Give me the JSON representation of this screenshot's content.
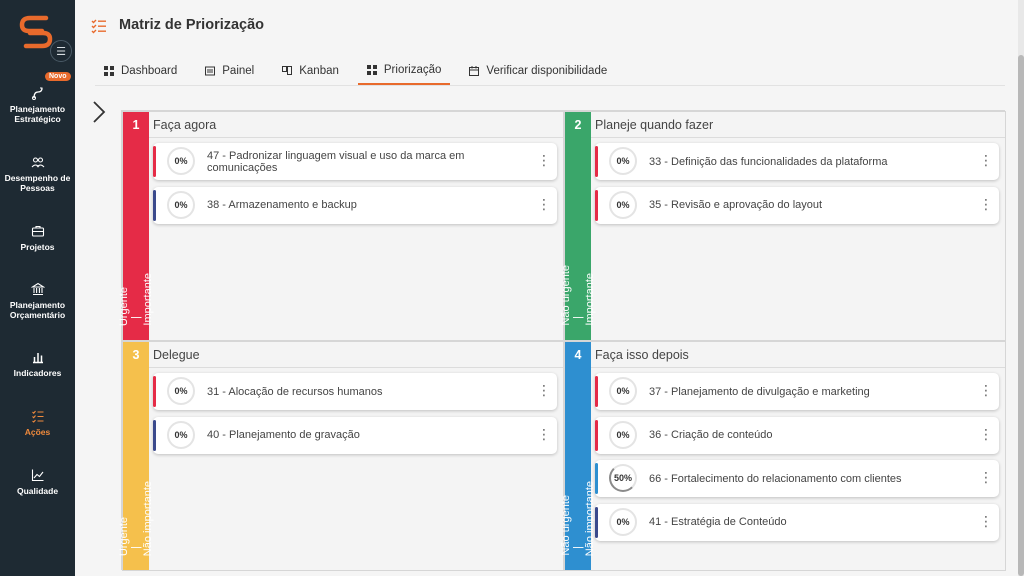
{
  "brand": {
    "accent": "#e86a2c",
    "sidebar_bg": "#1e2a33"
  },
  "sidebar": {
    "new_badge": "Novo",
    "items": [
      {
        "label": "Planejamento Estratégico",
        "icon": "route-icon"
      },
      {
        "label": "Desempenho de Pessoas",
        "icon": "people-icon"
      },
      {
        "label": "Projetos",
        "icon": "briefcase-icon"
      },
      {
        "label": "Planejamento Orçamentário",
        "icon": "bank-icon"
      },
      {
        "label": "Indicadores",
        "icon": "bar-chart-icon"
      },
      {
        "label": "Ações",
        "icon": "checklist-icon",
        "active": true
      },
      {
        "label": "Qualidade",
        "icon": "trend-icon"
      }
    ]
  },
  "header": {
    "title": "Matriz de Priorização",
    "tabs": [
      {
        "label": "Dashboard"
      },
      {
        "label": "Painel"
      },
      {
        "label": "Kanban"
      },
      {
        "label": "Priorização",
        "active": true
      },
      {
        "label": "Verificar disponibilidade"
      }
    ]
  },
  "quadrants": [
    {
      "num": "1",
      "title": "Faça agora",
      "label_a": "Urgente",
      "label_b": "Importante",
      "color": "#e52b47",
      "cards": [
        {
          "pct": "0%",
          "text": "47 - Padronizar linguagem visual e uso da marca em comunicações",
          "bar": "#e52b47"
        },
        {
          "pct": "0%",
          "text": "38 - Armazenamento e backup",
          "bar": "#3b4a8c"
        }
      ]
    },
    {
      "num": "2",
      "title": "Planeje quando fazer",
      "label_a": "Não urgente",
      "label_b": "Importante",
      "color": "#3aa66a",
      "cards": [
        {
          "pct": "0%",
          "text": "33 - Definição das funcionalidades da plataforma",
          "bar": "#e52b47"
        },
        {
          "pct": "0%",
          "text": "35 - Revisão e aprovação do layout",
          "bar": "#e52b47"
        }
      ]
    },
    {
      "num": "3",
      "title": "Delegue",
      "label_a": "Urgente",
      "label_b": "Não importante",
      "color": "#f5c04c",
      "cards": [
        {
          "pct": "0%",
          "text": "31 - Alocação de recursos humanos",
          "bar": "#e52b47"
        },
        {
          "pct": "0%",
          "text": "40 - Planejamento de gravação",
          "bar": "#3b4a8c"
        }
      ]
    },
    {
      "num": "4",
      "title": "Faça isso depois",
      "label_a": "Não urgente",
      "label_b": "Não importante",
      "color": "#2e8fd0",
      "cards": [
        {
          "pct": "0%",
          "text": "37 - Planejamento de divulgação e marketing",
          "bar": "#e52b47"
        },
        {
          "pct": "0%",
          "text": "36 - Criação de conteúdo",
          "bar": "#e52b47"
        },
        {
          "pct": "50%",
          "text": "66 - Fortalecimento do relacionamento com clientes",
          "bar": "#2e8fd0",
          "progress": 0.5
        },
        {
          "pct": "0%",
          "text": "41 - Estratégia de Conteúdo",
          "bar": "#3b4a8c"
        }
      ]
    }
  ]
}
